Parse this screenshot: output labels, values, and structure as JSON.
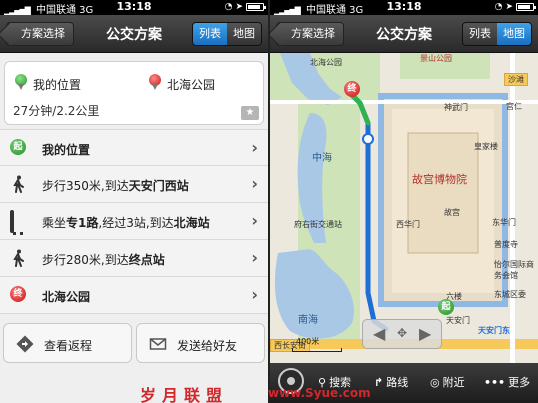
{
  "status_bar": {
    "carrier": "中国联通",
    "network": "3G",
    "time": "13:18"
  },
  "left": {
    "nav": {
      "back_label": "方案选择",
      "title": "公交方案",
      "seg_list": "列表",
      "seg_map": "地图",
      "active": "列表"
    },
    "summary": {
      "from": "我的位置",
      "to": "北海公园",
      "meta": "27分钟/2.2公里"
    },
    "steps": [
      {
        "icon": "start-badge-icon",
        "badge": "起",
        "text_before": "",
        "bold": "我的位置",
        "text_after": ""
      },
      {
        "icon": "walk-icon",
        "text_before": "步行350米,到达",
        "bold": "天安门西站",
        "text_after": ""
      },
      {
        "icon": "bus-icon",
        "text_before": "乘坐",
        "bold": "专1路",
        "text_mid": ",经过3站,到达",
        "bold2": "北海站"
      },
      {
        "icon": "walk-icon",
        "text_before": "步行280米,到达",
        "bold": "终点站",
        "text_after": ""
      },
      {
        "icon": "end-badge-icon",
        "badge": "终",
        "text_before": "",
        "bold": "北海公园",
        "text_after": ""
      }
    ],
    "actions": {
      "return_label": "查看返程",
      "share_label": "发送给好友"
    }
  },
  "right": {
    "nav": {
      "back_label": "方案选择",
      "title": "公交方案",
      "seg_list": "列表",
      "seg_map": "地图",
      "active": "地图"
    },
    "map_labels": {
      "beihai": "北海公园",
      "jingshan": "景山公园",
      "shatan": "沙滩",
      "shenwumen": "神武门",
      "zhonghai": "中海",
      "huangjia": "皇家楼",
      "gugong": "故宫博物院",
      "gugong_small": "故宫",
      "fuyou": "府右街交通站",
      "xihuamen": "西华门",
      "donghuamen": "东华门",
      "putong": "普度寺",
      "yihe": "怡尔国际商务会馆",
      "dongcheng": "东城区委",
      "nanhai": "南海",
      "liubei": "六楼",
      "xiangshan": "中山公园",
      "tiananmen_xi": "天安门",
      "tiananmen_dong": "天安门东",
      "changan": "西长安街",
      "guangmin": "宫仁",
      "liuxian": "六楼"
    },
    "scale_label": "400米",
    "start_badge": "起",
    "end_badge": "终",
    "toolbar": {
      "search": "搜索",
      "route": "路线",
      "nearby": "附近",
      "more": "更多"
    }
  },
  "watermark": {
    "left": "岁月联盟",
    "url": "www.Syue.com"
  },
  "colors": {
    "accent_blue": "#2a8ad8",
    "route_blue": "#3b7fe0",
    "start_green": "#1e8f1e",
    "end_red": "#c41010",
    "watermark_red": "#d0282c"
  }
}
